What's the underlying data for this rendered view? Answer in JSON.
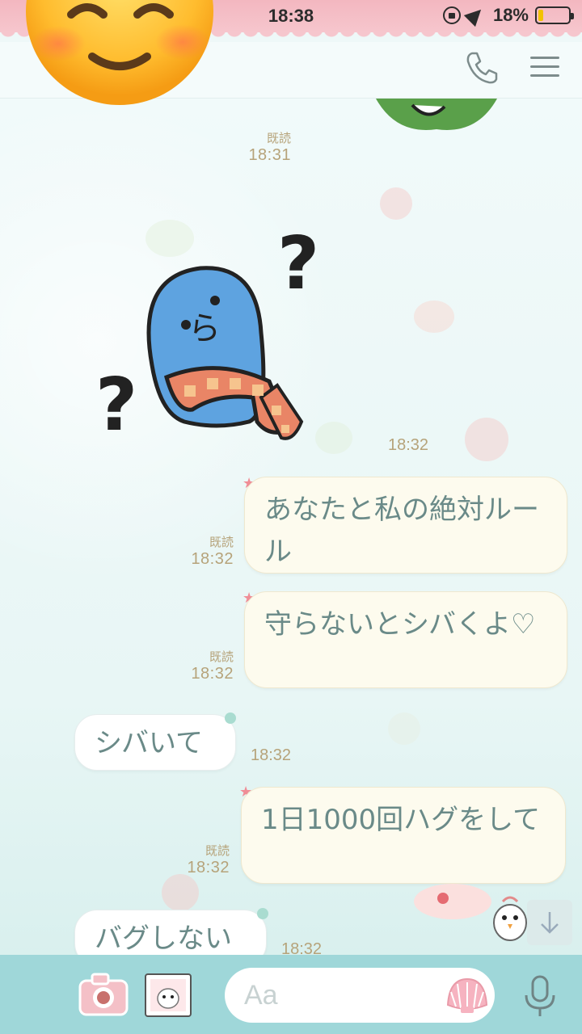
{
  "status_bar": {
    "time": "18:38",
    "battery_percent": "18%",
    "battery_level": 0.18
  },
  "header": {
    "call_icon": "phone-icon",
    "menu_icon": "hamburger-icon"
  },
  "messages": [
    {
      "side": "left-sticker",
      "read": "既読",
      "time": "18:31"
    },
    {
      "side": "left-sticker",
      "time": "18:32"
    },
    {
      "side": "right",
      "text": "あなたと私の絶対ルール",
      "read": "既読",
      "time": "18:32"
    },
    {
      "side": "right",
      "text": "守らないとシバくよ♡",
      "read": "既読",
      "time": "18:32"
    },
    {
      "side": "left",
      "text": "シバいて",
      "time": "18:32"
    },
    {
      "side": "right",
      "text": "1日1000回ハグをして",
      "read": "既読",
      "time": "18:32"
    },
    {
      "side": "left",
      "text": "バグしない",
      "time": "18:32"
    }
  ],
  "input": {
    "placeholder": "Aa"
  },
  "colors": {
    "accent": "#9fd7d9",
    "status_bar": "#f6c6cd",
    "meta_text": "#b6a37a",
    "bubble_text": "#6a8a88"
  },
  "icons": [
    "camera-icon",
    "album-sticker-icon",
    "shell-icon",
    "mic-icon",
    "arrow-down-icon"
  ]
}
